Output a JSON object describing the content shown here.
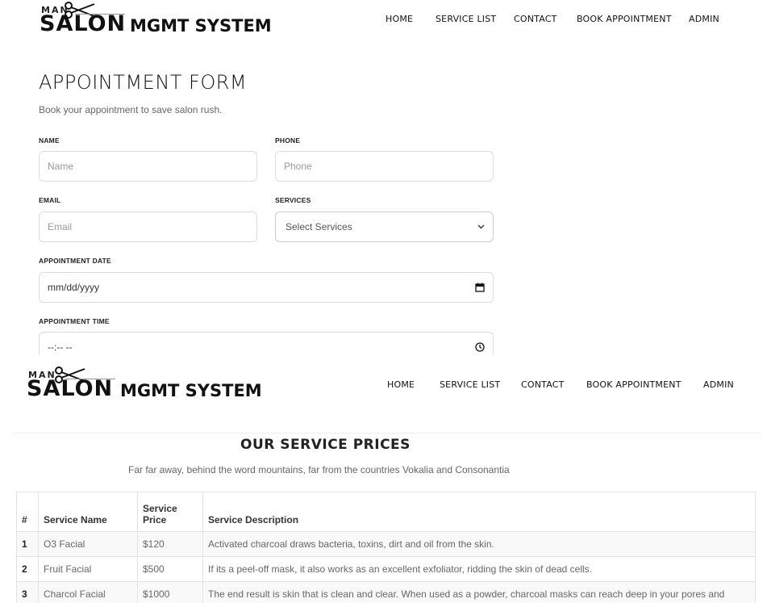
{
  "logo": {
    "man": "MAN",
    "salon": "SALON",
    "mgmt": "MGMT SYSTEM"
  },
  "nav": [
    {
      "label": "HOME"
    },
    {
      "label": "SERVICE LIST"
    },
    {
      "label": "CONTACT"
    },
    {
      "label": "BOOK APPOINTMENT"
    },
    {
      "label": "ADMIN"
    }
  ],
  "form": {
    "title": "APPOINTMENT FORM",
    "subtitle": "Book your appointment to save salon rush.",
    "name": {
      "label": "NAME",
      "placeholder": "Name"
    },
    "phone": {
      "label": "PHONE",
      "placeholder": "Phone"
    },
    "email": {
      "label": "EMAIL",
      "placeholder": "Email"
    },
    "services": {
      "label": "SERVICES",
      "value": "Select Services"
    },
    "date": {
      "label": "APPOINTMENT DATE",
      "value": "mm/dd/yyyy"
    },
    "time": {
      "label": "APPOINTMENT TIME",
      "value": "--:-- --"
    }
  },
  "services": {
    "title": "OUR SERVICE PRICES",
    "subtitle": "Far far away, behind the word mountains, far from the countries Vokalia and Consonantia",
    "headers": {
      "num": "#",
      "name": "Service Name",
      "price_line1": "Service",
      "price_line2": "Price",
      "desc": "Service Description"
    },
    "rows": [
      {
        "num": "1",
        "name": "O3 Facial",
        "price": "$120",
        "desc": "Activated charcoal draws bacteria, toxins, dirt and oil from the skin."
      },
      {
        "num": "2",
        "name": "Fruit Facial",
        "price": "$500",
        "desc": "If its a peel-off mask, it also works as an excellent exfoliator, ridding the skin of dead cells."
      },
      {
        "num": "3",
        "name": "Charcol Facial",
        "price": "$1000",
        "desc": "The end result is skin that is clean and clear. When used as a powder, charcoal masks can reach deep in your pores and"
      }
    ]
  }
}
